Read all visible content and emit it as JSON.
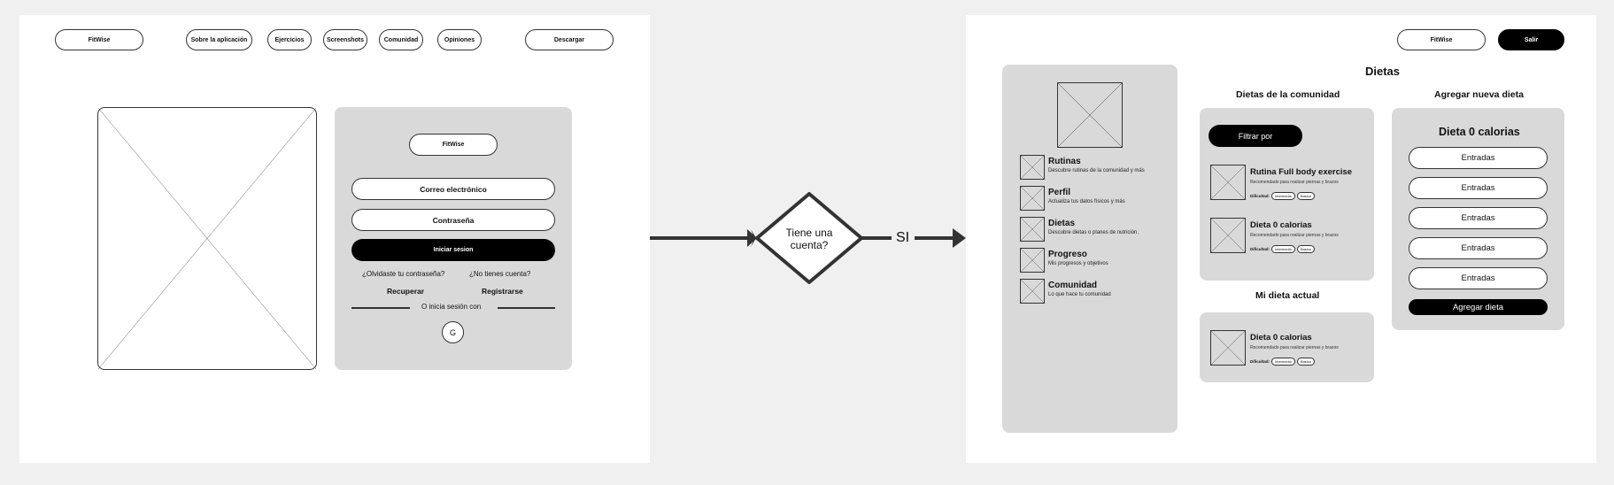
{
  "left_screen": {
    "nav": {
      "brand": "FitWise",
      "items": [
        "Sobre la aplicación",
        "Ejercicios",
        "Screenshots",
        "Comunidad",
        "Opiniones"
      ],
      "download": "Descargar"
    },
    "login": {
      "brand": "FitWise",
      "email": "Correo electrónico",
      "password": "Contraseña",
      "submit": "Iniciar sesion",
      "forgot": "¿Olvidaste tu contraseña?",
      "no_account": "¿No tienes cuenta?",
      "recover": "Recuperar",
      "register": "Registrarse",
      "or_login_with": "O inicia sesión con",
      "google": "G"
    }
  },
  "flow": {
    "decision": "Tiene una cuenta?",
    "yes_label": "SI"
  },
  "right_screen": {
    "header": {
      "brand": "FitWise",
      "logout": "Salir"
    },
    "page_title": "Dietas",
    "menu": [
      {
        "title": "Rutinas",
        "subtitle": "Descubre rutinas de la comunidad y más"
      },
      {
        "title": "Perfil",
        "subtitle": "Actualiza tus datos físicos y más"
      },
      {
        "title": "Dietas",
        "subtitle": "Descubre dietas o planes de nutrición."
      },
      {
        "title": "Progreso",
        "subtitle": "Mis progresos y objetivos"
      },
      {
        "title": "Comunidad",
        "subtitle": "Lo que hace tu comunidad"
      }
    ],
    "community": {
      "heading": "Dietas  de la comunidad",
      "filter": "Filtrar por",
      "cards": [
        {
          "title": "Rutina Full body exercise",
          "subtitle": "Recomendado para realizar piernas y brazos",
          "difficulty_label": "Dificultad:",
          "tags": [
            "Intermedio",
            "Basico"
          ]
        },
        {
          "title": "Dieta 0  calorias",
          "subtitle": "Recomendado para realizar piernas y brazos",
          "difficulty_label": "Dificultad:",
          "tags": [
            "Intermedio",
            "Basico"
          ]
        }
      ]
    },
    "current": {
      "heading": "Mi dieta actual",
      "card": {
        "title": "Dieta 0  calorias",
        "subtitle": "Recomendado para realizar piernas y brazos",
        "difficulty_label": "Dificultad:",
        "tags": [
          "Intermedio",
          "Basico"
        ]
      }
    },
    "new_diet": {
      "heading": "Agregar nueva dieta",
      "title": "Dieta 0 calorias",
      "entries": [
        "Entradas",
        "Entradas",
        "Entradas",
        "Entradas",
        "Entradas"
      ],
      "submit": "Agregar dieta"
    }
  }
}
